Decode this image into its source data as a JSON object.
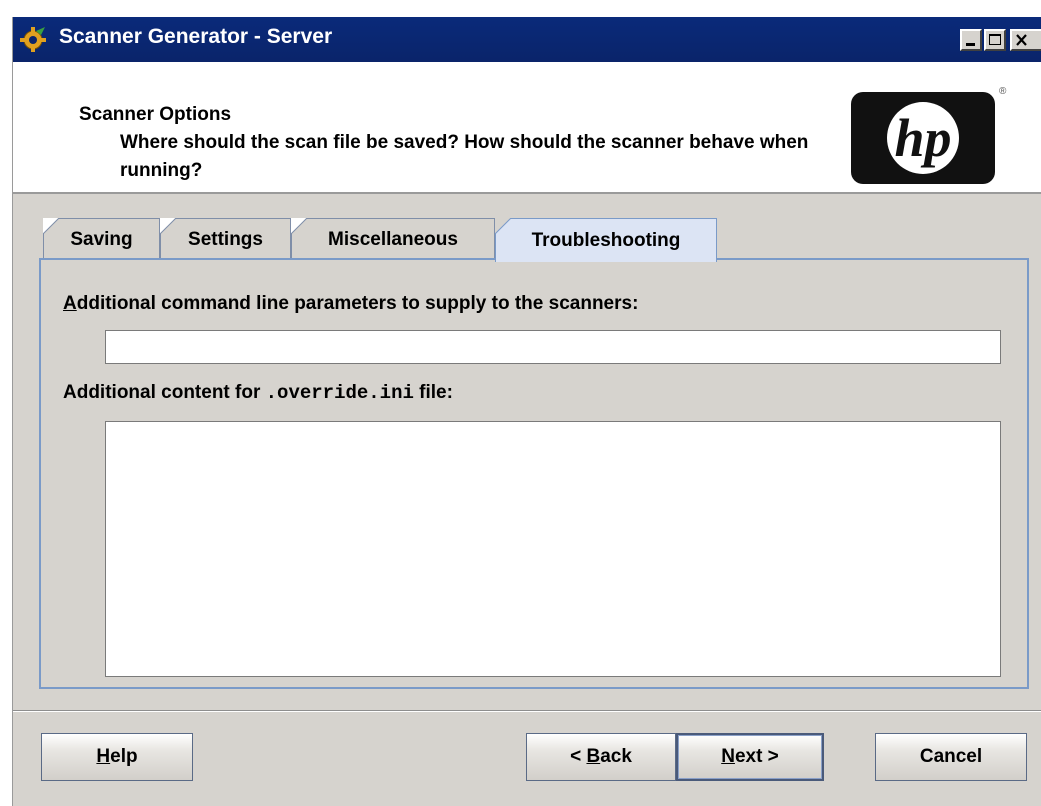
{
  "window": {
    "title": "Scanner Generator - Server",
    "controls": [
      "minimize-icon",
      "maximize-icon",
      "close-icon"
    ]
  },
  "header": {
    "title": "Scanner Options",
    "description": "Where should the scan file be saved?  How should the scanner behave when running?",
    "logo_text": "hp",
    "logo_mark": "®"
  },
  "tabs": [
    {
      "label": "Saving",
      "active": false
    },
    {
      "label": "Settings",
      "active": false
    },
    {
      "label": "Miscellaneous",
      "active": false
    },
    {
      "label": "Troubleshooting",
      "active": true
    }
  ],
  "troubleshooting": {
    "cmdline_label_mnemonic": "A",
    "cmdline_label_rest": "dditional command line parameters to supply to the scanners:",
    "cmdline_value": "",
    "override_label_prefix": "Additional content for ",
    "override_label_file": ".override.ini",
    "override_label_suffix": " file:",
    "override_value": ""
  },
  "buttons": {
    "help_mnemonic": "H",
    "help_rest": "elp",
    "back_prefix": "< ",
    "back_mnemonic": "B",
    "back_rest": "ack",
    "next_mnemonic": "N",
    "next_rest": "ext >",
    "cancel": "Cancel"
  },
  "colors": {
    "titlebar": "#0a246a",
    "window_bg": "#d6d3ce",
    "active_tab": "#dce4f4",
    "panel_border": "#7a9ac8"
  }
}
